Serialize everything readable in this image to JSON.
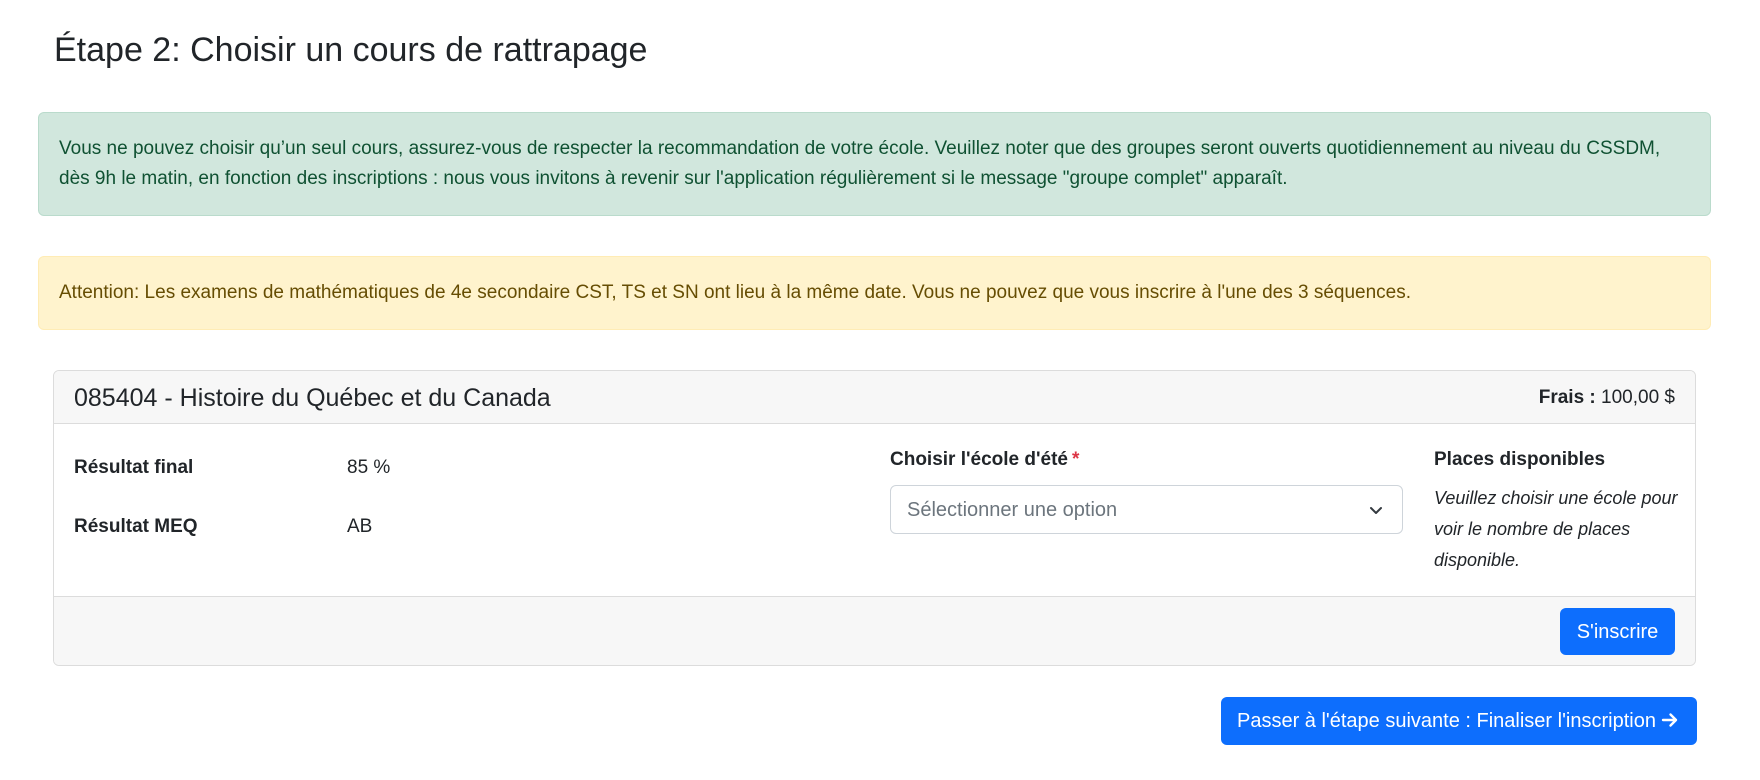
{
  "page": {
    "title": "Étape 2: Choisir un cours de rattrapage"
  },
  "alerts": {
    "info": "Vous ne pouvez choisir qu’un seul cours, assurez-vous de respecter la recommandation de votre école. Veuillez noter que des groupes seront ouverts quotidiennement au niveau du CSSDM, dès 9h le matin, en fonction des inscriptions : nous vous invitons à revenir sur l'application régulièrement si le message \"groupe complet\" apparaît.",
    "warning": "Attention: Les examens de mathématiques de 4e secondaire CST, TS et SN ont lieu à la même date. Vous ne pouvez que vous inscrire à l'une des 3 séquences."
  },
  "course": {
    "title": "085404 - Histoire du Québec et du Canada",
    "fees_label": "Frais :",
    "fees_value": "100,00 $",
    "results": [
      {
        "label": "Résultat final",
        "value": "85 %"
      },
      {
        "label": "Résultat MEQ",
        "value": "AB"
      }
    ],
    "school_field": {
      "label": "Choisir l'école d'été",
      "required_mark": "*",
      "selected": "Sélectionner une option"
    },
    "places": {
      "title": "Places disponibles",
      "text": "Veuillez choisir une école pour voir le nombre de places disponible."
    },
    "register_label": "S'inscrire"
  },
  "next_step_label": "Passer à l'étape suivante : Finaliser l'inscription",
  "icons": {
    "select": "chevron-down-icon",
    "next": "arrow-right-icon"
  },
  "colors": {
    "primary": "#0d6efd",
    "success_bg": "#d1e7dd",
    "success_text": "#0f5132",
    "warning_bg": "#fff3cd",
    "warning_text": "#664d03",
    "required": "#dc3545"
  }
}
